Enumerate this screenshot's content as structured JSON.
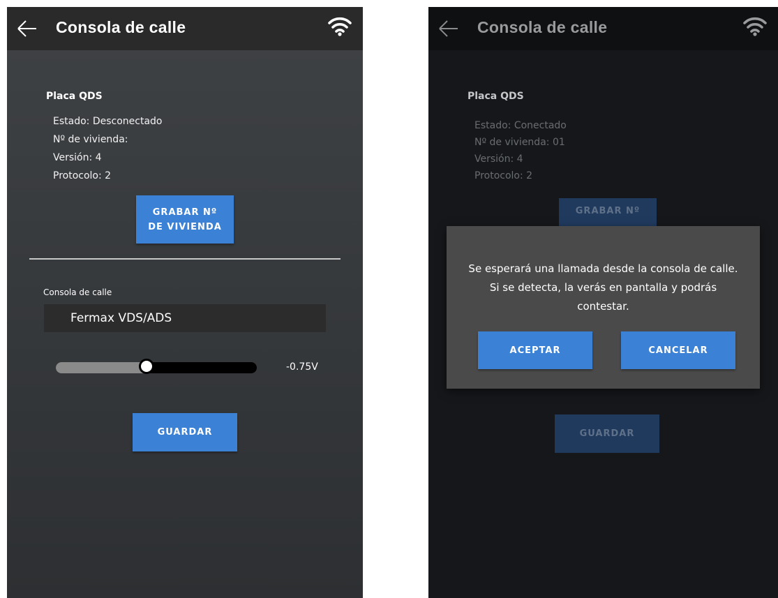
{
  "colors": {
    "accent": "#3b82d6",
    "appbar": "#2a2a2a",
    "dialog": "#4a4a4a"
  },
  "left": {
    "header": {
      "title": "Consola de calle",
      "back_icon": "arrow-left-icon",
      "wifi_icon": "wifi-icon"
    },
    "placa": {
      "title": "Placa QDS",
      "estado": "Estado: Desconectado",
      "vivienda": "Nº de vivienda:",
      "version": "Versión: 4",
      "protocolo": "Protocolo: 2"
    },
    "grabar_button": {
      "line1": "GRABAR Nº",
      "line2": "DE VIVIENDA"
    },
    "consola": {
      "label": "Consola de calle",
      "selected": "Fermax VDS/ADS"
    },
    "slider": {
      "value_label": "-0.75V",
      "fraction": 0.45
    },
    "guardar_button": "GUARDAR"
  },
  "right": {
    "header": {
      "title": "Consola de calle",
      "back_icon": "arrow-left-icon",
      "wifi_icon": "wifi-icon"
    },
    "placa": {
      "title": "Placa QDS",
      "estado": "Estado: Conectado",
      "vivienda": "Nº de vivienda: 01",
      "version": "Versión: 4",
      "protocolo": "Protocolo: 2"
    },
    "grabar_button": "GRABAR Nº",
    "guardar_button": "GUARDAR",
    "dialog": {
      "message": "Se esperará una llamada desde la consola de calle. Si se detecta, la verás en pantalla y podrás contestar.",
      "accept": "ACEPTAR",
      "cancel": "CANCELAR"
    }
  }
}
